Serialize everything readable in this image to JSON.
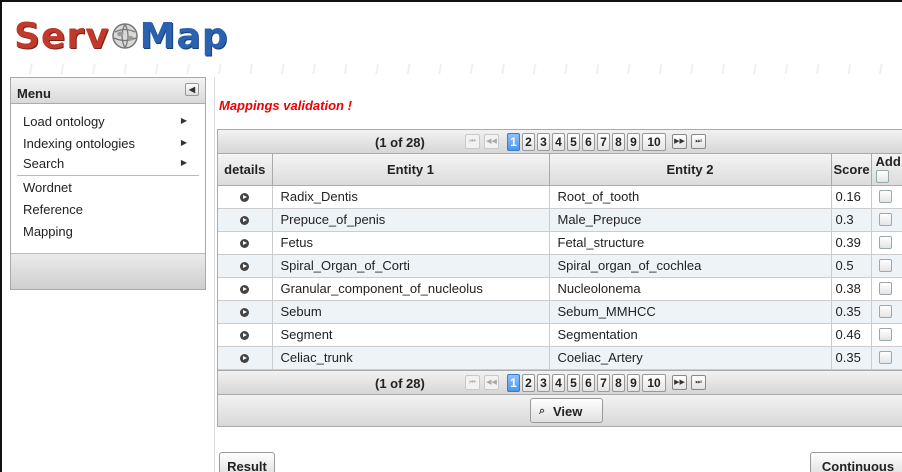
{
  "app": {
    "logo_left": "Serv",
    "logo_right": "Map"
  },
  "sidebar": {
    "title": "Menu",
    "items": [
      {
        "label": "Load ontology",
        "submenu": true
      },
      {
        "label": "Indexing ontologies",
        "submenu": true
      },
      {
        "label": "Search",
        "submenu": true
      },
      {
        "label": "Wordnet",
        "submenu": false
      },
      {
        "label": "Reference",
        "submenu": false
      },
      {
        "label": "Mapping",
        "submenu": false
      }
    ]
  },
  "main": {
    "title": "Mappings validation !",
    "paginator": {
      "current_report": "(1 of 28)",
      "pages": [
        "1",
        "2",
        "3",
        "4",
        "5",
        "6",
        "7",
        "8",
        "9",
        "10"
      ],
      "active_page": "1"
    },
    "columns": {
      "details": "details",
      "entity1": "Entity 1",
      "entity2": "Entity 2",
      "score": "Score",
      "add": "Add"
    },
    "rows": [
      {
        "entity1": "Radix_Dentis",
        "entity2": "Root_of_tooth",
        "score": "0.16"
      },
      {
        "entity1": "Prepuce_of_penis",
        "entity2": "Male_Prepuce",
        "score": "0.3"
      },
      {
        "entity1": "Fetus",
        "entity2": "Fetal_structure",
        "score": "0.39"
      },
      {
        "entity1": "Spiral_Organ_of_Corti",
        "entity2": "Spiral_organ_of_cochlea",
        "score": "0.5"
      },
      {
        "entity1": "Granular_component_of_nucleolus",
        "entity2": "Nucleolonema",
        "score": "0.38"
      },
      {
        "entity1": "Sebum",
        "entity2": "Sebum_MMHCC",
        "score": "0.35"
      },
      {
        "entity1": "Segment",
        "entity2": "Segmentation",
        "score": "0.46"
      },
      {
        "entity1": "Celiac_trunk",
        "entity2": "Coeliac_Artery",
        "score": "0.35"
      }
    ],
    "view_label": "View",
    "result_label": "Result",
    "continuous_label": "Continuous"
  },
  "colors": {
    "title_red": "#e00000",
    "page_active": "#4d97e9",
    "logo_red": "#c0392b",
    "logo_blue": "#2a62b0"
  }
}
